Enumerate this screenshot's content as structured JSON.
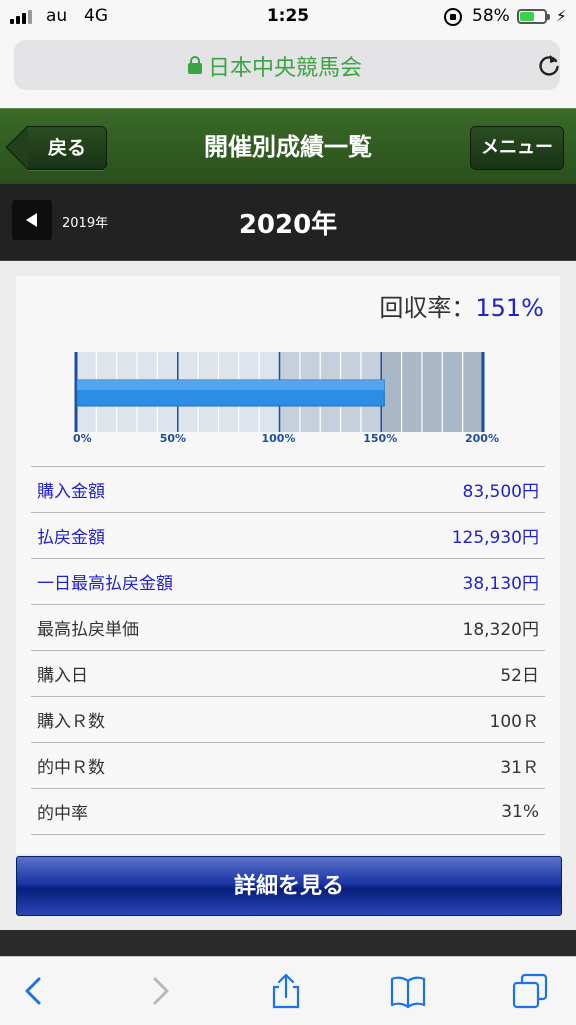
{
  "status": {
    "carrier": "au",
    "network": "4G",
    "time": "1:25",
    "battery_pct": "58%",
    "battery_level": 0.58
  },
  "browser": {
    "site_name": "日本中央競馬会",
    "icons": [
      "lock-icon",
      "reload-icon",
      "back-icon",
      "forward-icon",
      "share-icon",
      "bookmarks-icon",
      "tabs-icon"
    ]
  },
  "header": {
    "back_label": "戻る",
    "title": "開催別成績一覧",
    "menu_label": "メニュー"
  },
  "year_nav": {
    "prev_year": "2019年",
    "current_year": "2020年"
  },
  "summary": {
    "recovery_label": "回収率：",
    "recovery_value": "151%",
    "recovery_fraction": 1.51
  },
  "chart": {
    "tick_labels": [
      "0%",
      "50%",
      "100%",
      "150%",
      "200%"
    ],
    "max": 2.0,
    "colors": {
      "bar": "#2d8de6",
      "bg_light": "#dde4ec",
      "bg_dark": "#aab7c6",
      "tick": "#1f4f9a"
    }
  },
  "stats": [
    {
      "label": "購入金額",
      "value": "83,500円"
    },
    {
      "label": "払戻金額",
      "value": "125,930円"
    },
    {
      "label": "一日最高払戻金額",
      "value": "38,130円"
    },
    {
      "label": "最高払戻単価",
      "value": "18,320円"
    },
    {
      "label": "購入日",
      "value": "52日"
    },
    {
      "label": "購入Ｒ数",
      "value": "100Ｒ"
    },
    {
      "label": "的中Ｒ数",
      "value": "31Ｒ"
    },
    {
      "label": "的中率",
      "value": "31%"
    }
  ],
  "detail_button": "詳細を見る"
}
